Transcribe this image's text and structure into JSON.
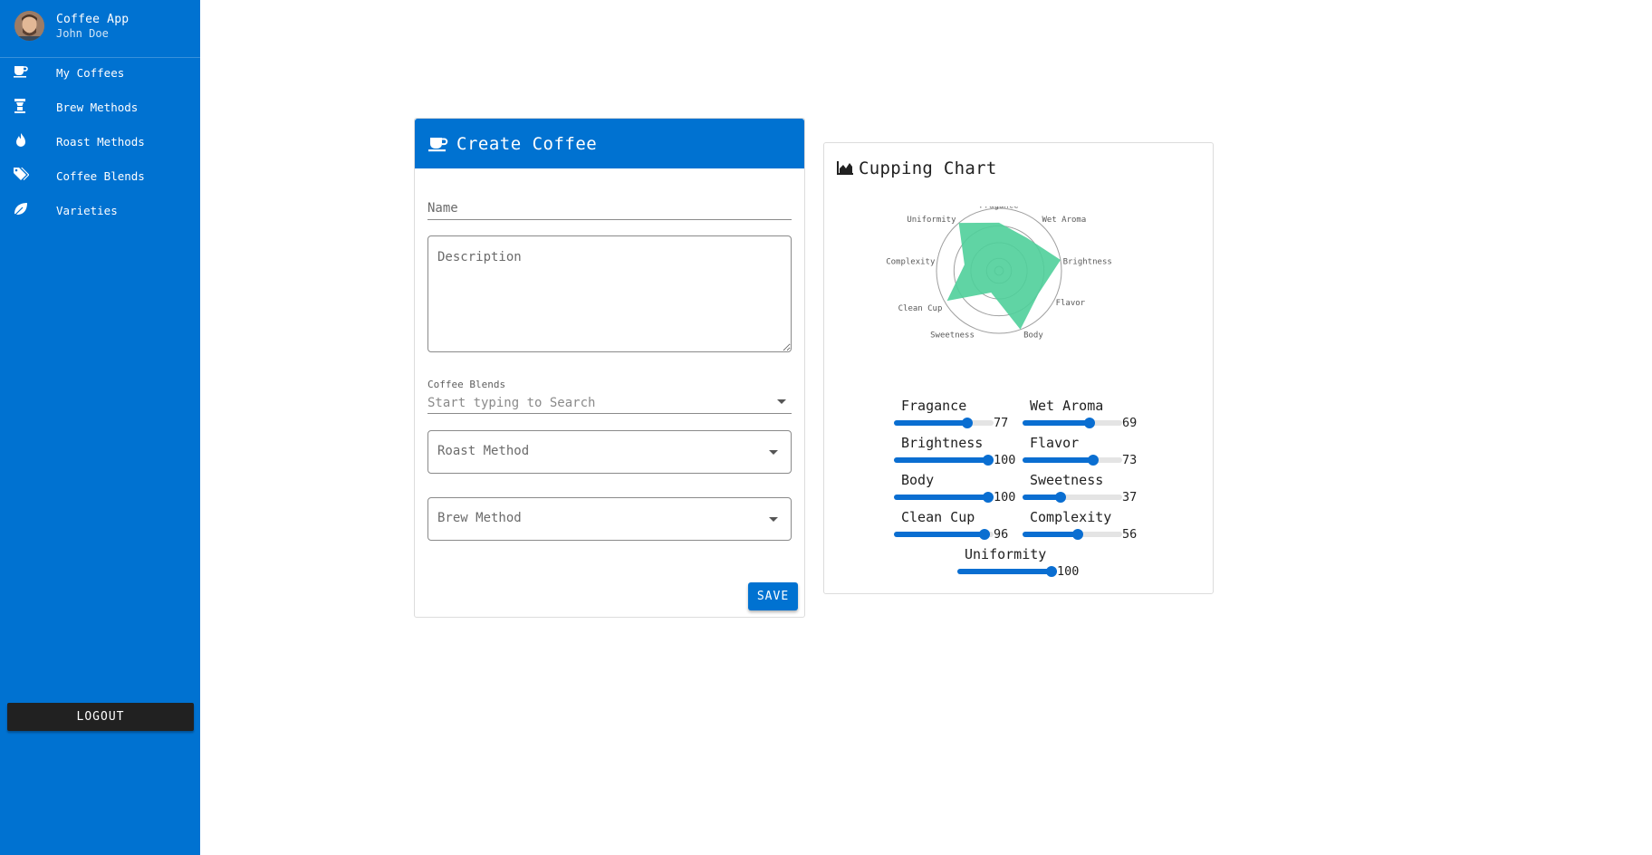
{
  "sidebar": {
    "app_name": "Coffee App",
    "user_name": "John Doe",
    "items": [
      {
        "label": "My Coffees",
        "icon": "coffee-cup-icon"
      },
      {
        "label": "Brew Methods",
        "icon": "coffee-maker-icon"
      },
      {
        "label": "Roast Methods",
        "icon": "fire-icon"
      },
      {
        "label": "Coffee Blends",
        "icon": "tags-icon"
      },
      {
        "label": "Varieties",
        "icon": "leaf-icon"
      }
    ],
    "logout_label": "LOGOUT",
    "accent_color": "#0072d1"
  },
  "create_coffee": {
    "title": "Create Coffee",
    "icon": "coffee-cup-icon",
    "name_placeholder": "Name",
    "description_placeholder": "Description",
    "blends_label": "Coffee Blends",
    "blends_placeholder": "Start typing to Search",
    "roast_method_label": "Roast Method",
    "brew_method_label": "Brew Method",
    "save_label": "SAVE"
  },
  "cupping": {
    "title": "Cupping Chart",
    "icon": "area-chart-icon",
    "sliders": [
      {
        "label": "Fragance",
        "value": 77
      },
      {
        "label": "Wet Aroma",
        "value": 69
      },
      {
        "label": "Brightness",
        "value": 100
      },
      {
        "label": "Flavor",
        "value": 73
      },
      {
        "label": "Body",
        "value": 100
      },
      {
        "label": "Sweetness",
        "value": 37
      },
      {
        "label": "Clean Cup",
        "value": 96
      },
      {
        "label": "Complexity",
        "value": 56
      },
      {
        "label": "Uniformity",
        "value": 100
      }
    ]
  },
  "chart_data": {
    "type": "radar",
    "categories": [
      "Fragance",
      "Wet Aroma",
      "Brightness",
      "Flavor",
      "Body",
      "Sweetness",
      "Clean Cup",
      "Complexity",
      "Uniformity"
    ],
    "values": [
      77,
      69,
      100,
      73,
      100,
      37,
      96,
      56,
      100
    ],
    "range": [
      0,
      100
    ],
    "fill_color": "#4fcf9a",
    "grid": true
  }
}
